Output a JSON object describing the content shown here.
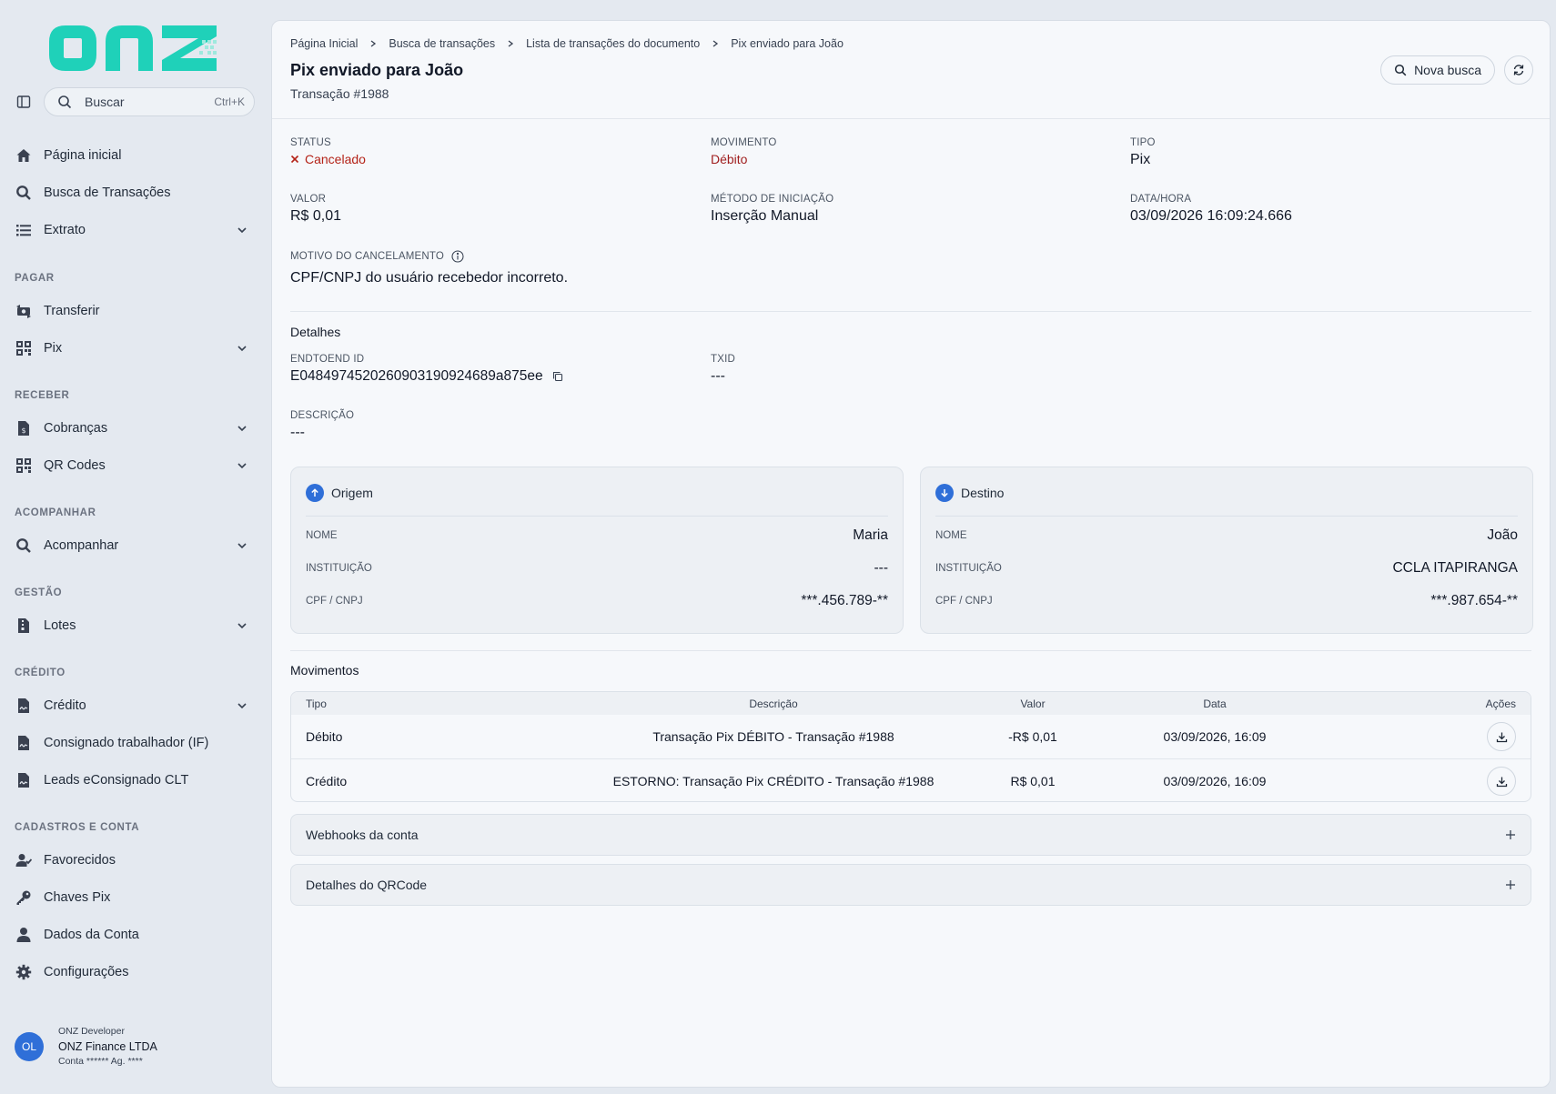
{
  "colors": {
    "brand": "#1fd1b9",
    "accent": "#2f6fd8",
    "danger": "#b42318",
    "debit": "#a01f1f"
  },
  "logo": {
    "text": "onz"
  },
  "search": {
    "placeholder": "Buscar",
    "shortcut": "Ctrl+K"
  },
  "sidebar": {
    "items": [
      {
        "label": "Página inicial",
        "icon": "home-icon"
      },
      {
        "label": "Busca de Transações",
        "icon": "search-icon"
      },
      {
        "label": "Extrato",
        "icon": "list-icon",
        "expandable": true
      }
    ],
    "sections": [
      {
        "title": "PAGAR",
        "items": [
          {
            "label": "Transferir",
            "icon": "money-transfer-icon"
          },
          {
            "label": "Pix",
            "icon": "qr-grid-icon",
            "expandable": true
          }
        ]
      },
      {
        "title": "RECEBER",
        "items": [
          {
            "label": "Cobranças",
            "icon": "invoice-icon",
            "expandable": true
          },
          {
            "label": "QR Codes",
            "icon": "qr-grid-icon",
            "expandable": true
          }
        ]
      },
      {
        "title": "ACOMPANHAR",
        "items": [
          {
            "label": "Acompanhar",
            "icon": "search-icon",
            "expandable": true
          }
        ]
      },
      {
        "title": "GESTÃO",
        "items": [
          {
            "label": "Lotes",
            "icon": "file-zip-icon",
            "expandable": true
          }
        ]
      },
      {
        "title": "CRÉDITO",
        "items": [
          {
            "label": "Crédito",
            "icon": "file-signature-icon",
            "expandable": true
          },
          {
            "label": "Consignado trabalhador (IF)",
            "icon": "file-signature-icon"
          },
          {
            "label": "Leads eConsignado CLT",
            "icon": "file-signature-icon"
          }
        ]
      },
      {
        "title": "CADASTROS E CONTA",
        "items": [
          {
            "label": "Favorecidos",
            "icon": "user-check-icon"
          },
          {
            "label": "Chaves Pix",
            "icon": "key-icon"
          },
          {
            "label": "Dados da Conta",
            "icon": "user-icon"
          },
          {
            "label": "Configurações",
            "icon": "gear-icon"
          }
        ]
      }
    ]
  },
  "user": {
    "initials": "OL",
    "role": "ONZ Developer",
    "company": "ONZ Finance LTDA",
    "account": "Conta ****** Ag. ****"
  },
  "breadcrumb": [
    "Página Inicial",
    "Busca de transações",
    "Lista de transações do documento",
    "Pix enviado para João"
  ],
  "header": {
    "title": "Pix enviado para João",
    "subtitle": "Transação #1988",
    "new_search": "Nova busca"
  },
  "summary": {
    "status_label": "STATUS",
    "status_value": "Cancelado",
    "movement_label": "MOVIMENTO",
    "movement_value": "Débito",
    "type_label": "TIPO",
    "type_value": "Pix",
    "amount_label": "VALOR",
    "amount_value": "R$ 0,01",
    "method_label": "MÉTODO DE INICIAÇÃO",
    "method_value": "Inserção Manual",
    "datetime_label": "DATA/HORA",
    "datetime_value": "03/09/2026 16:09:24.666",
    "cancel_reason_label": "MOTIVO DO CANCELAMENTO",
    "cancel_reason_value": "CPF/CNPJ do usuário recebedor incorreto."
  },
  "details": {
    "title": "Detalhes",
    "e2e_label": "ENDTOEND ID",
    "e2e_value": "E04849745202609031909246 89a875ee",
    "txid_label": "TXID",
    "txid_value": "---",
    "description_label": "DESCRIÇÃO",
    "description_value": "---"
  },
  "origin": {
    "title": "Origem",
    "name_label": "NOME",
    "name": "Maria",
    "institution_label": "INSTITUIÇÃO",
    "institution": "---",
    "doc_label": "CPF / CNPJ",
    "doc": "***.456.789-**"
  },
  "destination": {
    "title": "Destino",
    "name_label": "NOME",
    "name": "João",
    "institution_label": "INSTITUIÇÃO",
    "institution": "CCLA ITAPIRANGA",
    "doc_label": "CPF / CNPJ",
    "doc": "***.987.654-**"
  },
  "movements": {
    "title": "Movimentos",
    "columns": {
      "type": "Tipo",
      "description": "Descrição",
      "amount": "Valor",
      "date": "Data",
      "actions": "Ações"
    },
    "rows": [
      {
        "type": "Débito",
        "description": "Transação Pix DÉBITO - Transação #1988",
        "amount": "-R$ 0,01",
        "date": "03/09/2026, 16:09"
      },
      {
        "type": "Crédito",
        "description": "ESTORNO: Transação Pix CRÉDITO - Transação #1988",
        "amount": "R$ 0,01",
        "date": "03/09/2026, 16:09"
      }
    ]
  },
  "accordions": {
    "webhooks": "Webhooks da conta",
    "qrcode": "Detalhes do QRCode"
  }
}
